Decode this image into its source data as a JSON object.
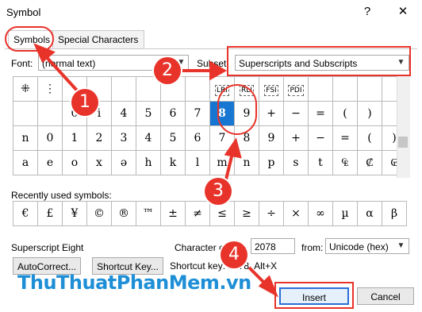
{
  "window": {
    "title": "Symbol",
    "help_label": "?",
    "close_label": "✕"
  },
  "tabs": [
    {
      "label": "Symbols"
    },
    {
      "label": "Special Characters"
    }
  ],
  "font": {
    "label": "Font:",
    "value": "(normal text)"
  },
  "subset": {
    "label": "Subset:",
    "value": "Superscripts and Subscripts"
  },
  "grid_rows": [
    [
      "⁜",
      "⋮",
      "",
      "",
      "",
      "",
      "",
      "",
      "LRI",
      "RLI",
      "FSI",
      "PDI",
      "",
      "",
      "",
      ""
    ],
    [
      "",
      "",
      "0",
      "i",
      "4",
      "5",
      "6",
      "7",
      "8",
      "9",
      "+",
      "−",
      "=",
      "(",
      ")",
      ""
    ],
    [
      "n",
      "0",
      "1",
      "2",
      "3",
      "4",
      "5",
      "6",
      "7",
      "8",
      "9",
      "+",
      "−",
      "=",
      "(",
      ")"
    ],
    [
      "a",
      "e",
      "o",
      "x",
      "ə",
      "h",
      "k",
      "l",
      "m",
      "n",
      "p",
      "s",
      "t",
      "₠",
      "₡",
      "₢"
    ]
  ],
  "recent": {
    "label": "Recently used symbols:",
    "symbols": [
      "€",
      "£",
      "¥",
      "©",
      "®",
      "™",
      "±",
      "≠",
      "≤",
      "≥",
      "÷",
      "×",
      "∞",
      "µ",
      "α",
      "β"
    ]
  },
  "char_name": "Superscript Eight",
  "character_code": {
    "label": "Character code:",
    "value": "2078"
  },
  "from": {
    "label": "from:",
    "value": "Unicode (hex)"
  },
  "buttons": {
    "autocorrect": "AutoCorrect...",
    "shortcut_key": "Shortcut Key...",
    "insert": "Insert",
    "cancel": "Cancel"
  },
  "shortcut": {
    "label": "Shortcut key:",
    "value": "2078, Alt+X"
  },
  "annotations": [
    "1",
    "2",
    "3",
    "4"
  ],
  "watermark": "ThuThuatPhanMem.vn",
  "colors": {
    "annotation": "#e8332a",
    "selection": "#1776d2",
    "watermark": "#1e8fd6"
  }
}
